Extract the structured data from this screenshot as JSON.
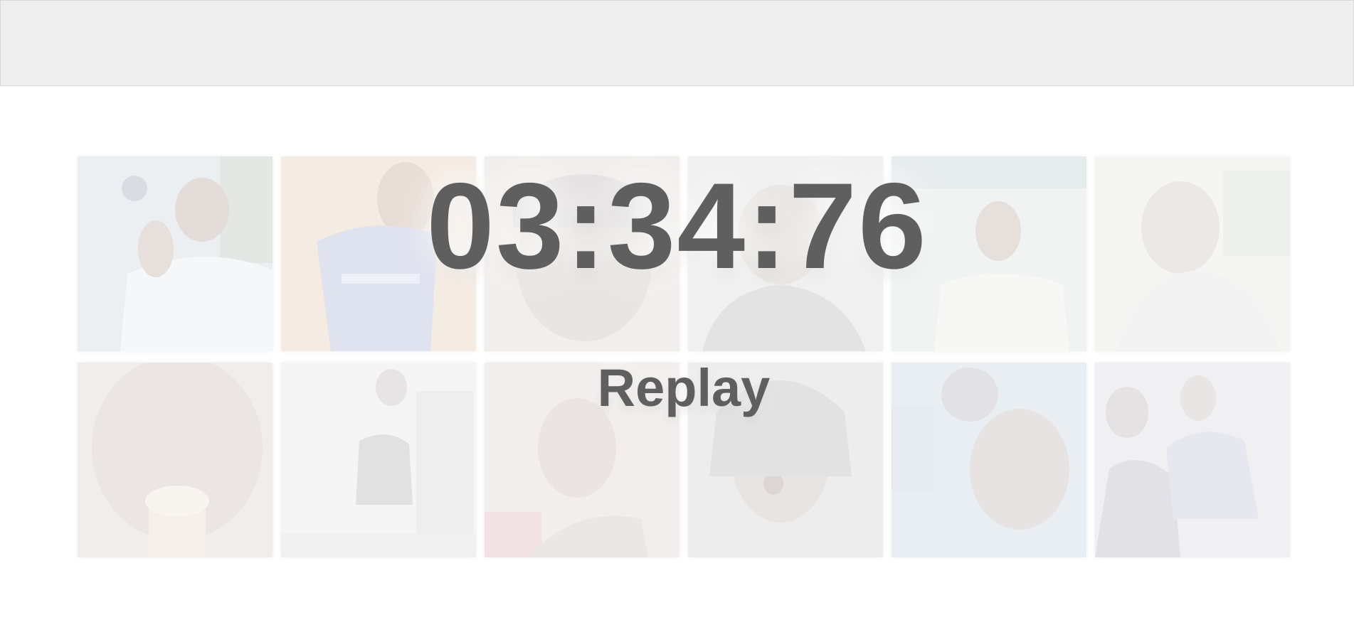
{
  "timer": {
    "value": "03:34:76"
  },
  "replay": {
    "label": "Replay"
  },
  "photos": [
    {
      "name": "photo-waving",
      "tint": "#e9ecef"
    },
    {
      "name": "photo-blue-jersey",
      "tint": "#f1e6dc"
    },
    {
      "name": "photo-closeup",
      "tint": "#efeded"
    },
    {
      "name": "photo-dark-shirt",
      "tint": "#ececec"
    },
    {
      "name": "photo-sign",
      "tint": "#eef2f0"
    },
    {
      "name": "photo-glasses",
      "tint": "#f2f2f2"
    },
    {
      "name": "photo-ice-cream",
      "tint": "#efecec"
    },
    {
      "name": "photo-jumping",
      "tint": "#f3f3f3"
    },
    {
      "name": "photo-selfie",
      "tint": "#f0ecec"
    },
    {
      "name": "photo-shouting",
      "tint": "#ededed"
    },
    {
      "name": "photo-pool",
      "tint": "#e9eef3"
    },
    {
      "name": "photo-two-friends",
      "tint": "#eeeef2"
    }
  ]
}
